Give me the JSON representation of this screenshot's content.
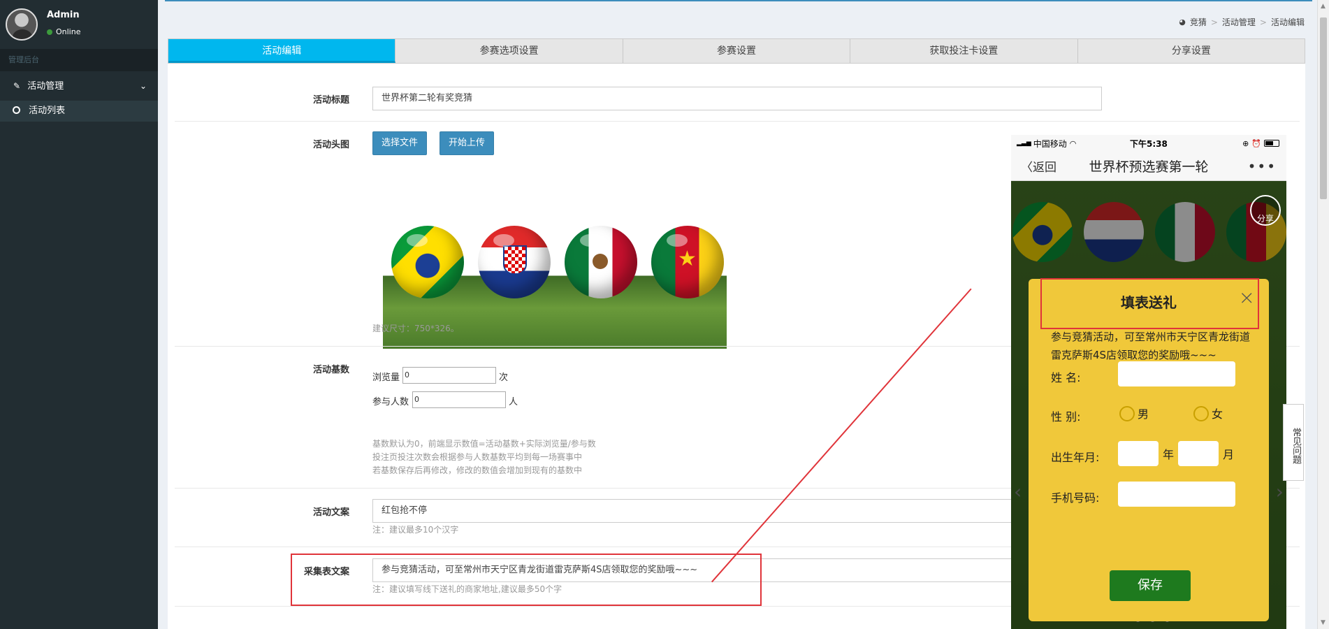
{
  "user": {
    "name": "Admin",
    "status": "Online"
  },
  "sidebar": {
    "header": "管理后台",
    "menu": {
      "label": "活动管理",
      "chevron": "⌄"
    },
    "submenu": [
      {
        "label": "活动列表"
      }
    ]
  },
  "breadcrumb": {
    "items": [
      "竞猜",
      "活动管理",
      "活动编辑"
    ],
    "sep": ">"
  },
  "tabs": [
    {
      "label": "活动编辑",
      "active": true
    },
    {
      "label": "参赛选项设置"
    },
    {
      "label": "参赛设置"
    },
    {
      "label": "获取投注卡设置"
    },
    {
      "label": "分享设置"
    }
  ],
  "form": {
    "title_label": "活动标题",
    "title_value": "世界杯第二轮有奖竞猜",
    "image_label": "活动头图",
    "choose_file": "选择文件",
    "start_upload": "开始上传",
    "image_hint": "建议尺寸：750*326。",
    "base_label": "活动基数",
    "views_label": "浏览量",
    "views_value": "0",
    "views_unit": "次",
    "participants_label": "参与人数",
    "participants_value": "0",
    "participants_unit": "人",
    "base_hint_1": "基数默认为0，前端显示数值=活动基数+实际浏览量/参与数",
    "base_hint_2": "投注页投注次数会根据参与人数基数平均到每一场赛事中",
    "base_hint_3": "若基数保存后再修改，修改的数值会增加到现有的基数中",
    "copy_label": "活动文案",
    "copy_value": "红包抢不停",
    "copy_hint": "注：建议最多10个汉字",
    "collect_label": "采集表文案",
    "collect_value": "参与竞猜活动，可至常州市天宁区青龙街道雷克萨斯4S店领取您的奖励哦~~~",
    "collect_hint": "注：建议填写线下送礼的商家地址,建议最多50个字"
  },
  "phone": {
    "carrier": "中国移动",
    "time": "下午5:38",
    "back": "返回",
    "title": "世界杯预选赛第一轮",
    "more": "•••",
    "share": "分享",
    "modal": {
      "title": "填表送礼",
      "close": "×",
      "desc": "参与竞猜活动，可至常州市天宁区青龙街道雷克萨斯4S店领取您的奖励哦~~~",
      "name_label": "姓 名:",
      "gender_label": "性 别:",
      "male": "男",
      "female": "女",
      "birth_label": "出生年月:",
      "year": "年",
      "month": "月",
      "phone_label": "手机号码:",
      "save": "保存"
    }
  },
  "faq": "常见问题",
  "colors": {
    "accent": "#00b7ee",
    "sidebar": "#222d32",
    "highlight": "#e0343a",
    "modal": "#f0c83a",
    "save": "#1e7a1e"
  }
}
